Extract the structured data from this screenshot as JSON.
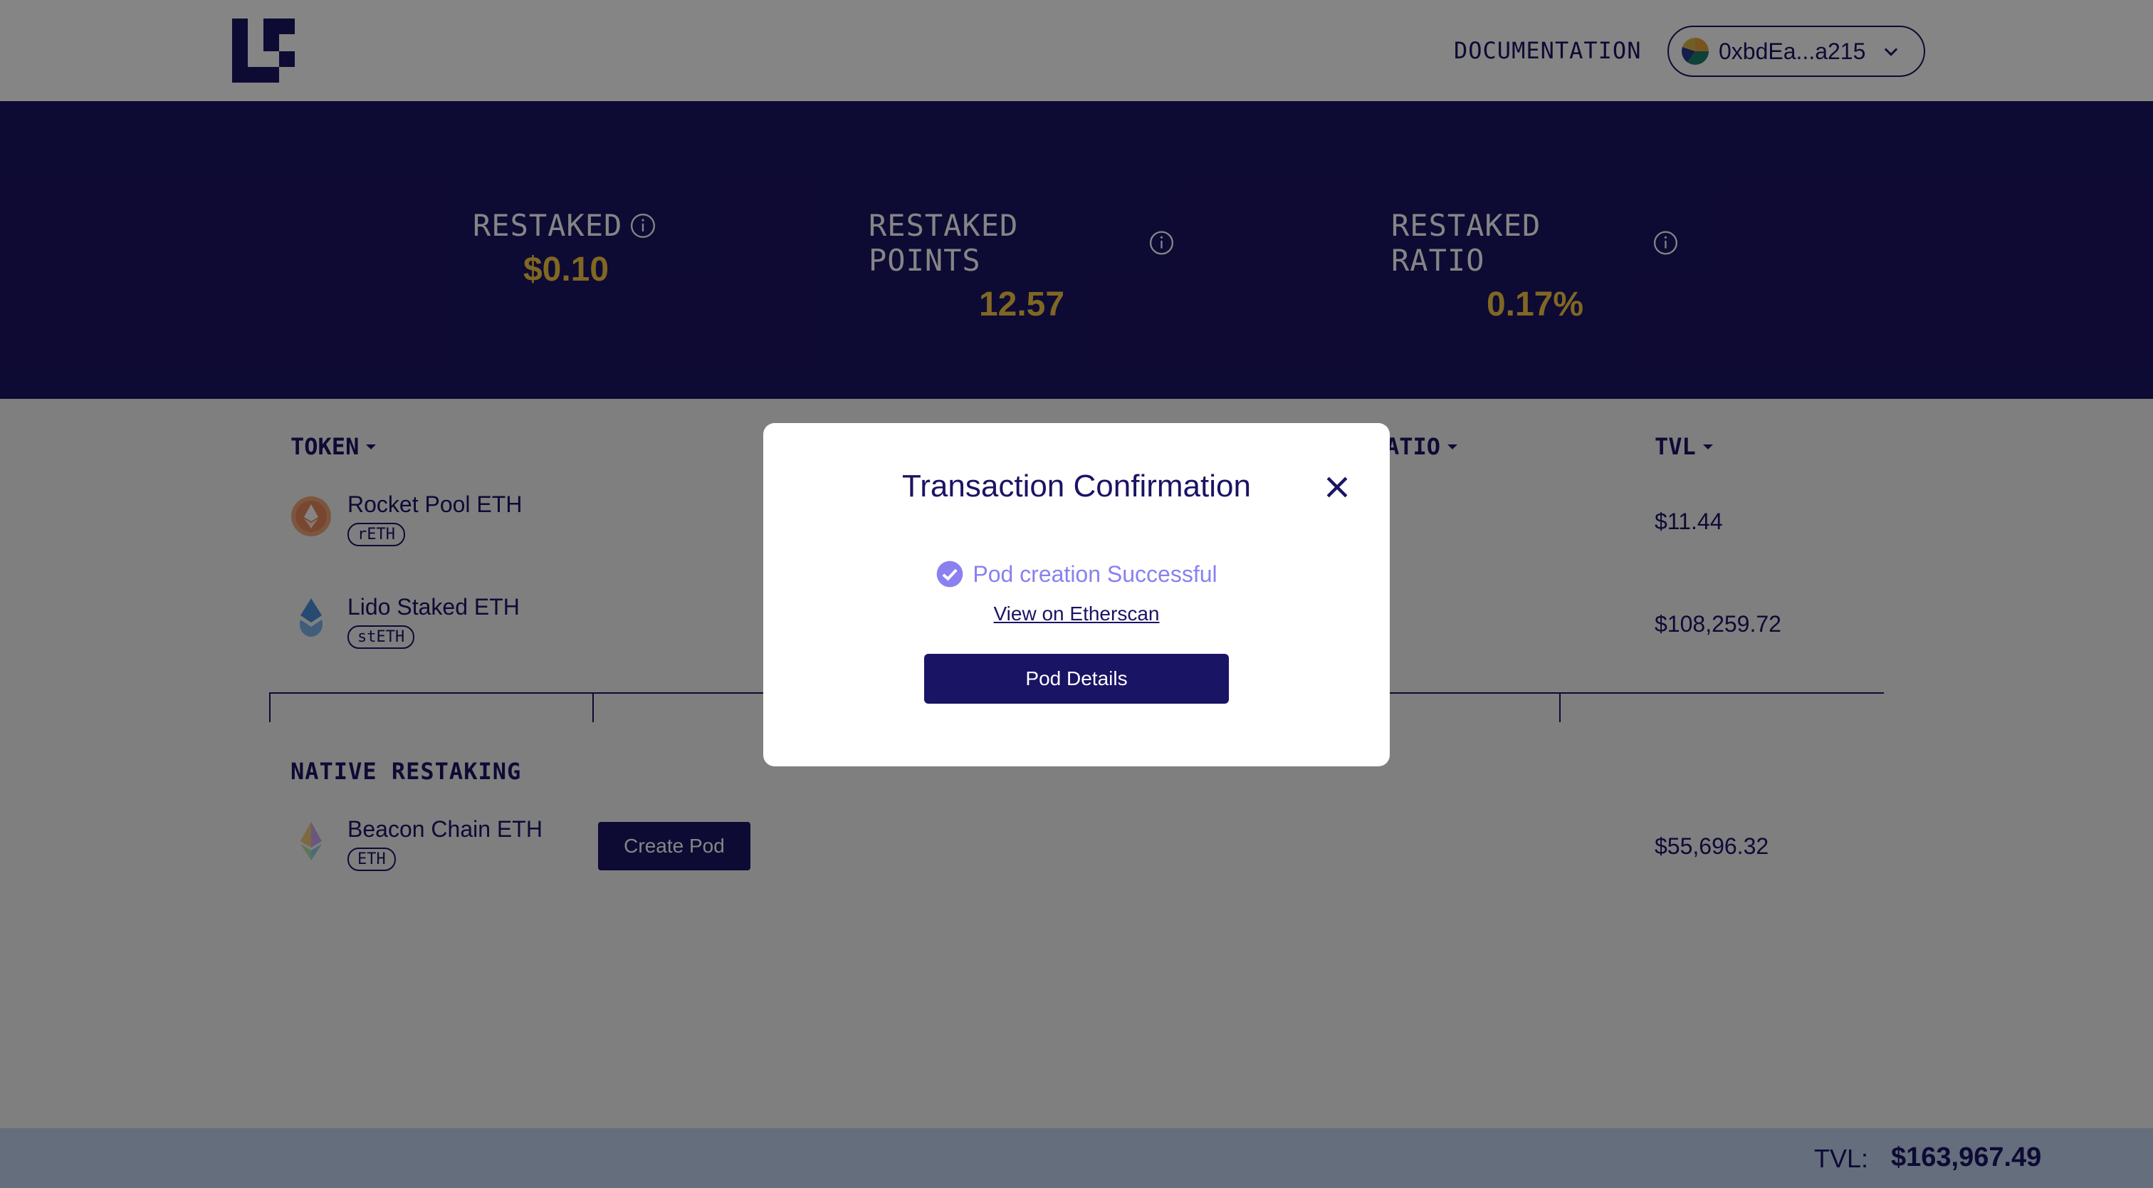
{
  "header": {
    "documentation_label": "DOCUMENTATION",
    "wallet_address": "0xbdEa...a215"
  },
  "stats": [
    {
      "label": "RESTAKED",
      "value": "$0.10"
    },
    {
      "label": "RESTAKED POINTS",
      "value": "12.57"
    },
    {
      "label": "RESTAKED RATIO",
      "value": "0.17%"
    }
  ],
  "table": {
    "columns": {
      "token": "TOKEN",
      "ratio": "ATIO",
      "tvl": "TVL"
    },
    "rows": [
      {
        "name": "Rocket Pool ETH",
        "symbol": "rETH",
        "tvl": "$11.44"
      },
      {
        "name": "Lido Staked ETH",
        "symbol": "stETH",
        "tvl": "$108,259.72"
      }
    ]
  },
  "native": {
    "section_title": "NATIVE RESTAKING",
    "row": {
      "name": "Beacon Chain ETH",
      "symbol": "ETH",
      "tvl": "$55,696.32"
    },
    "create_pod_label": "Create Pod"
  },
  "footer": {
    "tvl_label": "TVL:",
    "tvl_value": "$163,967.49"
  },
  "modal": {
    "title": "Transaction Confirmation",
    "success_text": "Pod creation Successful",
    "etherscan_link": "View on Etherscan",
    "pod_details_label": "Pod Details"
  },
  "colors": {
    "brand": "#1a1464",
    "accent_gold": "#f5c542",
    "success_purple": "#8a80f0",
    "footer_bg": "#c2d3ee"
  }
}
